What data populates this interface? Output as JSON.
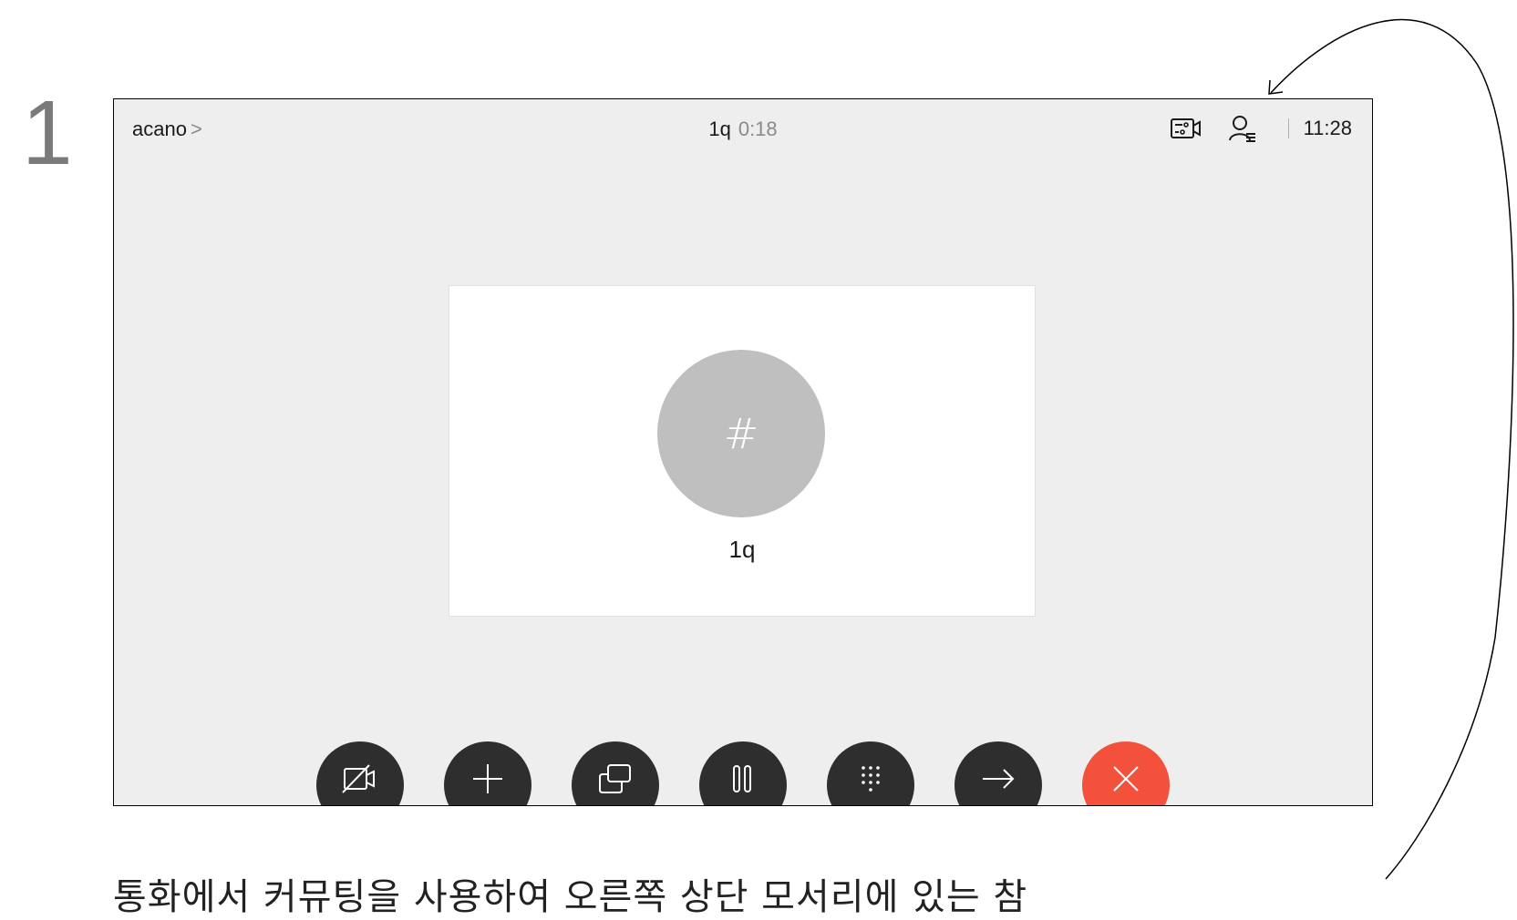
{
  "step_number": "1",
  "header": {
    "call_name": "acano",
    "chevron": ">",
    "title_name": "1q",
    "title_duration": "0:18",
    "clock": "11:28",
    "icons": [
      "video-layout-icon",
      "participants-icon"
    ]
  },
  "tile": {
    "avatar_glyph": "#",
    "label": "1q"
  },
  "controls": [
    {
      "name": "camera-off-button",
      "icon": "camera-off-icon"
    },
    {
      "name": "add-call-button",
      "icon": "plus-icon"
    },
    {
      "name": "share-button",
      "icon": "share-screen-icon"
    },
    {
      "name": "hold-button",
      "icon": "pause-icon"
    },
    {
      "name": "keypad-button",
      "icon": "keypad-icon"
    },
    {
      "name": "transfer-button",
      "icon": "arrow-right-icon"
    },
    {
      "name": "end-call-button",
      "icon": "close-icon"
    }
  ],
  "colors": {
    "screen_bg": "#eeeeee",
    "control_bg": "#2e2e2e",
    "end_call": "#f4513d",
    "avatar_bg": "#bfbfbf"
  },
  "caption": "통화에서 커뮤팅을 사용하여 오른쪽 상단 모서리에 있는 참"
}
